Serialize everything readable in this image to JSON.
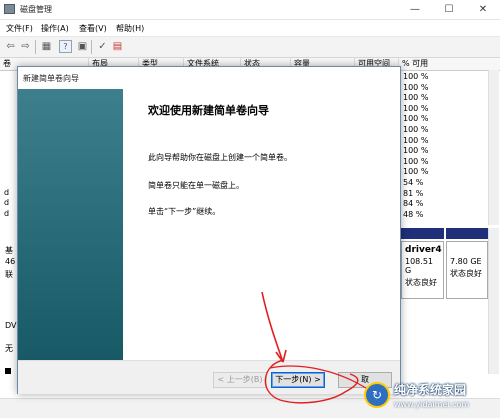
{
  "window": {
    "title": "磁盘管理",
    "minimize_glyph": "—",
    "maximize_glyph": "☐",
    "close_glyph": "✕"
  },
  "menu": [
    "文件(F)",
    "操作(A)",
    "查看(V)",
    "帮助(H)"
  ],
  "toolbar": {
    "icons": [
      "back-arrow-icon",
      "forward-arrow-icon",
      "console-tree-icon",
      "help-icon",
      "properties-icon",
      "check-icon",
      "disk-icon"
    ],
    "glyphs": [
      "⇦",
      "⇨",
      "▦",
      "?",
      "▣",
      "✓",
      "▤"
    ]
  },
  "volume_table": {
    "columns": [
      "卷",
      "布局",
      "类型",
      "文件系统",
      "状态",
      "容量",
      "可用空间",
      "% 可用"
    ],
    "free_percent": [
      "100 %",
      "100 %",
      "100 %",
      "100 %",
      "100 %",
      "100 %",
      "100 %",
      "100 %",
      "100 %",
      "100 %",
      "54 %",
      "81 %",
      "84 %",
      "48 %"
    ],
    "left_fragments": [
      "",
      "",
      "",
      "",
      "",
      "",
      "",
      "",
      "",
      "",
      "",
      "d",
      "d",
      "d"
    ]
  },
  "disk_panel": {
    "left_labels": [
      "基",
      "46",
      "联",
      "DV",
      "无"
    ],
    "partitions": [
      {
        "name": "driver4",
        "size": "108.51 G",
        "status": "状态良好"
      },
      {
        "name": "",
        "size": "7.80 GE",
        "status": "状态良好"
      }
    ]
  },
  "wizard": {
    "title": "新建简单卷向导",
    "heading": "欢迎使用新建简单卷向导",
    "paragraphs": [
      "此向导帮助你在磁盘上创建一个简单卷。",
      "简单卷只能在单一磁盘上。",
      "单击“下一步”继续。"
    ],
    "back_button": "< 上一步(B)",
    "next_button": "下一步(N) >",
    "cancel_button": "取"
  },
  "watermark": {
    "title": "纯净系统家园",
    "url": "www.yidaimei.com"
  },
  "colors": {
    "desktop": "#1b6f83",
    "wizard_side_top": "#3d7f8d",
    "wizard_side_bottom": "#175a66",
    "disk_bar": "#1f2f7a",
    "annotation": "#e02020"
  }
}
